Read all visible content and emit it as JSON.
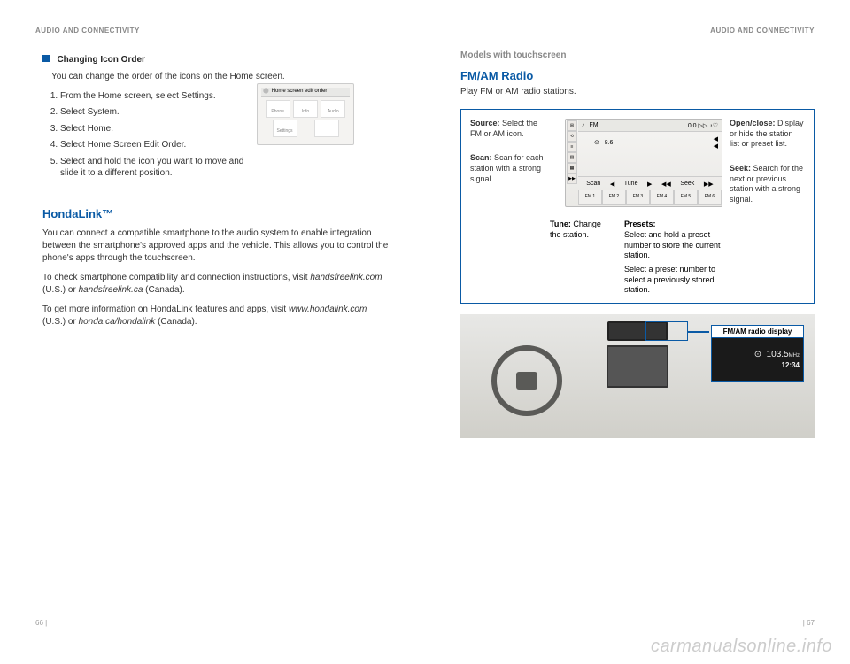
{
  "left": {
    "header": "AUDIO AND CONNECTIVITY",
    "section1_title": "Changing Icon Order",
    "section1_intro": "You can change the order of the icons on the Home screen.",
    "steps": [
      "From the Home screen, select Settings.",
      "Select System.",
      "Select Home.",
      "Select Home Screen Edit Order.",
      "Select and hold the icon you want to move and slide it to a different position."
    ],
    "img_caption": "Home screen edit order",
    "img_icons": [
      "Phone",
      "Info",
      "Audio",
      "Settings",
      ""
    ],
    "hondalink_title": "HondaLink™",
    "hondalink_p1": "You can connect a compatible smartphone to the audio system to enable integration between the smartphone's approved apps and the vehicle. This allows you to control the phone's apps through the touchscreen.",
    "hondalink_p2a": "To check smartphone compatibility and connection instructions, visit ",
    "hondalink_p2_link1": "handsfreelink.com",
    "hondalink_p2b": " (U.S.) or ",
    "hondalink_p2_link2": "handsfreelink.ca",
    "hondalink_p2c": " (Canada).",
    "hondalink_p3a": "To get more information on HondaLink features and apps, visit ",
    "hondalink_p3_link1": "www.hondalink.com",
    "hondalink_p3b": " (U.S.) or ",
    "hondalink_p3_link2": "honda.ca/hondalink",
    "hondalink_p3c": " (Canada).",
    "pagenum": "66  |"
  },
  "right": {
    "header": "AUDIO AND CONNECTIVITY",
    "models": "Models with touchscreen",
    "title": "FM/AM Radio",
    "subtitle": "Play FM or AM radio stations.",
    "labels": {
      "source_t": "Source:",
      "source_d": " Select the FM or AM icon.",
      "scan_t": "Scan:",
      "scan_d": " Scan for each station with a strong signal.",
      "open_t": "Open/close:",
      "open_d": " Display or hide the station list or preset list.",
      "seek_t": "Seek:",
      "seek_d": " Search for the next or previous station with a strong signal.",
      "tune_t": "Tune:",
      "tune_d": " Change the station.",
      "presets_t": "Presets:",
      "presets_d1": "Select and hold a preset number to store the current station.",
      "presets_d2": "Select a preset number to select a previously stored station."
    },
    "radio_screen": {
      "band": "FM",
      "scan": "Scan",
      "tune": "Tune",
      "seek": "Seek",
      "presets": [
        "FM 1",
        "FM 2",
        "FM 3",
        "FM 4",
        "FM 5",
        "FM 6"
      ]
    },
    "callout_title": "FM/AM radio display",
    "callout_freq": "103.5",
    "callout_unit": "MHz",
    "callout_time": "12:34",
    "pagenum": "|  67"
  },
  "watermark": "carmanualsonline.info"
}
